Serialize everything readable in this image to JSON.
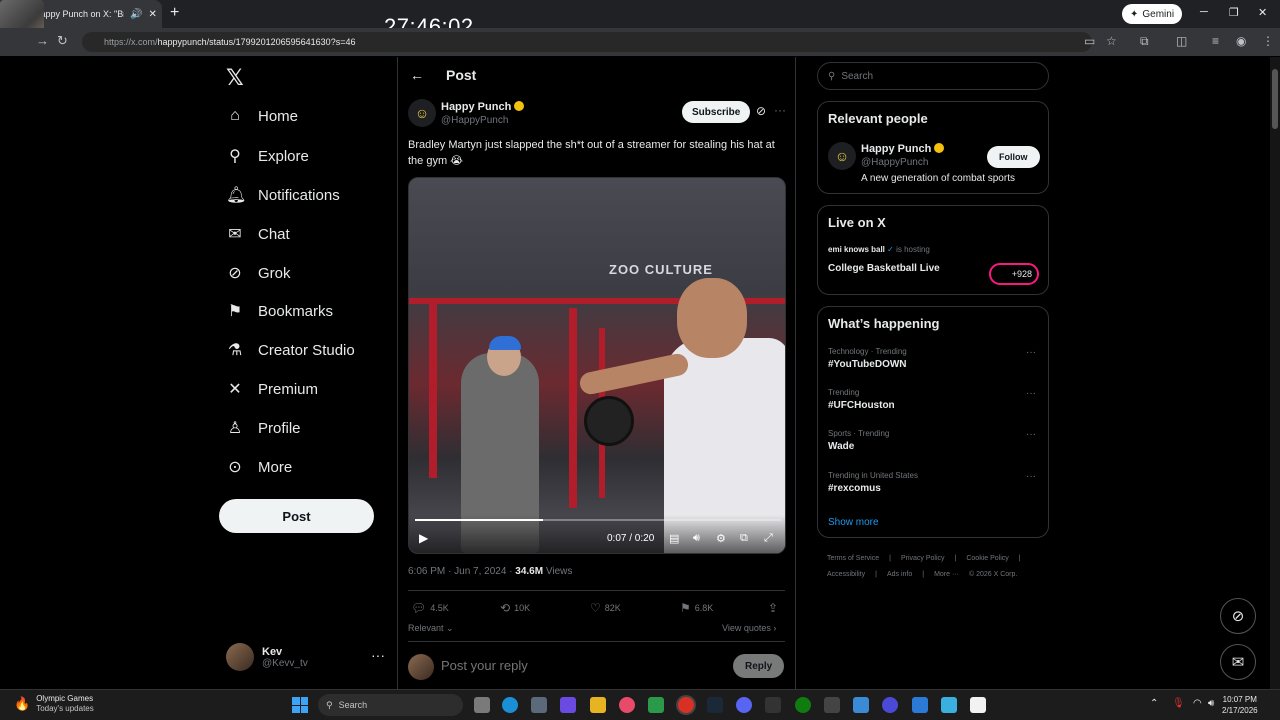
{
  "browser": {
    "tab_title": "Happy Punch on X: \"Bradley",
    "url_host": "https://x.com/",
    "url_path": "happypunch/status/1799201206595641630?s=46",
    "gemini_label": "Gemini",
    "overlay_timer": "27:46:02"
  },
  "nav": {
    "items": [
      {
        "label": "Home",
        "icon": "home-icon"
      },
      {
        "label": "Explore",
        "icon": "search-icon"
      },
      {
        "label": "Notifications",
        "icon": "bell-icon"
      },
      {
        "label": "Chat",
        "icon": "mail-icon"
      },
      {
        "label": "Grok",
        "icon": "grok-icon"
      },
      {
        "label": "Bookmarks",
        "icon": "bookmark-icon"
      },
      {
        "label": "Creator Studio",
        "icon": "flask-icon"
      },
      {
        "label": "Premium",
        "icon": "x-icon"
      },
      {
        "label": "Profile",
        "icon": "person-icon"
      },
      {
        "label": "More",
        "icon": "more-circle-icon"
      }
    ],
    "post_button": "Post",
    "account": {
      "name": "Kev",
      "handle": "@Kevv_tv"
    }
  },
  "post": {
    "header_title": "Post",
    "author_name": "Happy Punch",
    "author_handle": "@HappyPunch",
    "subscribe_label": "Subscribe",
    "text": "Bradley Martyn just slapped the sh*t out of a streamer for stealing his hat at the gym 😭",
    "video_sign": "ZOO CULTURE",
    "video_time": "0:07 / 0:20",
    "video_progress": 0.35,
    "timestamp": "6:06 PM · Jun 7, 2024 · ",
    "views_count": "34.6M",
    "views_label": " Views",
    "stats": {
      "replies": "4.5K",
      "reposts": "10K",
      "likes": "82K",
      "bookmarks": "6.8K"
    },
    "relevant_label": "Relevant",
    "view_quotes": "View quotes",
    "reply_placeholder": "Post your reply",
    "reply_button": "Reply"
  },
  "sidebar": {
    "search_placeholder": "Search",
    "relevant_people": {
      "title": "Relevant people",
      "name": "Happy Punch",
      "handle": "@HappyPunch",
      "bio": "A new generation of combat sports",
      "follow_label": "Follow"
    },
    "live": {
      "title": "Live on X",
      "host": "emi knows ball",
      "hosting_text": "is hosting",
      "event": "College Basketball Live",
      "count": "+928"
    },
    "happening": {
      "title": "What’s happening",
      "trends": [
        {
          "category": "Technology · Trending",
          "name": "#YouTubeDOWN"
        },
        {
          "category": "Trending",
          "name": "#UFCHouston"
        },
        {
          "category": "Sports · Trending",
          "name": "Wade"
        },
        {
          "category": "Trending in United States",
          "name": "#rexcomus"
        }
      ],
      "show_more": "Show more"
    },
    "footer": [
      "Terms of Service",
      "|",
      "Privacy Policy",
      "|",
      "Cookie Policy",
      "|",
      "Accessibility",
      "|",
      "Ads info",
      "|",
      "More ···",
      "© 2026 X Corp."
    ]
  },
  "taskbar": {
    "news_title": "Olympic Games",
    "news_sub": "Today's updates",
    "search_label": "Search",
    "time": "10:07 PM",
    "date": "2/17/2026"
  }
}
